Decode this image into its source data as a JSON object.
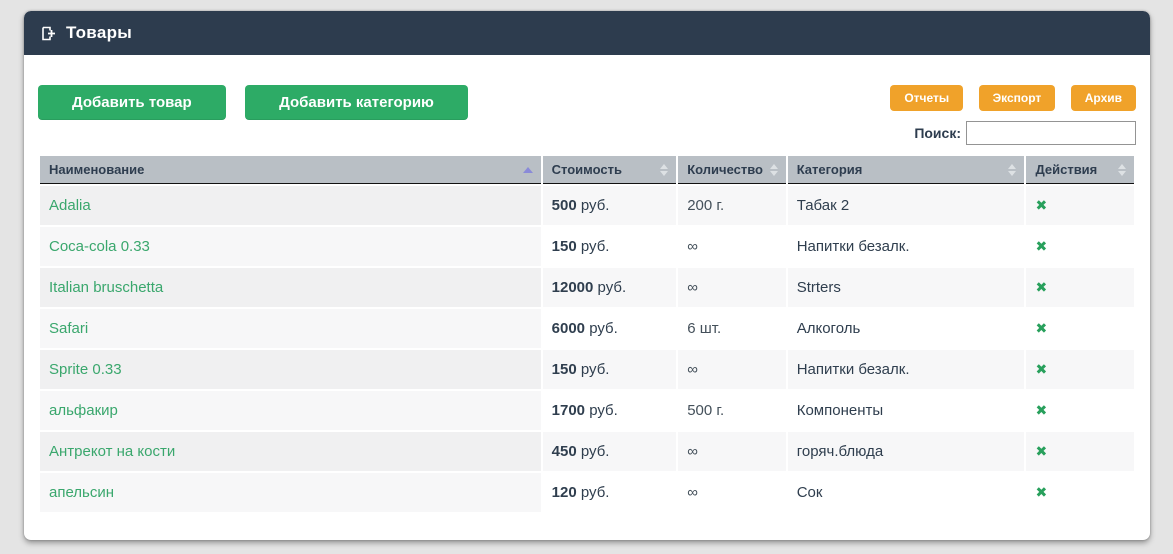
{
  "header": {
    "title": "Товары"
  },
  "toolbar": {
    "add_product_label": "Добавить товар",
    "add_category_label": "Добавить категорию",
    "reports_label": "Отчеты",
    "export_label": "Экспорт",
    "archive_label": "Архив",
    "search_label": "Поиск:",
    "search_value": ""
  },
  "table": {
    "action_icon": "✖",
    "columns": [
      {
        "label": "Наименование",
        "sort": "asc"
      },
      {
        "label": "Стоимость",
        "sort": "none"
      },
      {
        "label": "Количество",
        "sort": "none"
      },
      {
        "label": "Категория",
        "sort": "none"
      },
      {
        "label": "Действия",
        "sort": "none"
      }
    ],
    "rows": [
      {
        "name": "Adalia",
        "price": "500",
        "price_unit": "руб.",
        "quantity": "200 г.",
        "category": "Табак 2"
      },
      {
        "name": "Coca-cola 0.33",
        "price": "150",
        "price_unit": "руб.",
        "quantity": "∞",
        "category": "Напитки безалк."
      },
      {
        "name": "Italian bruschetta",
        "price": "12000",
        "price_unit": "руб.",
        "quantity": "∞",
        "category": "Strters"
      },
      {
        "name": "Safari",
        "price": "6000",
        "price_unit": "руб.",
        "quantity": "6 шт.",
        "category": "Алкоголь"
      },
      {
        "name": "Sprite 0.33",
        "price": "150",
        "price_unit": "руб.",
        "quantity": "∞",
        "category": "Напитки безалк."
      },
      {
        "name": "альфакир",
        "price": "1700",
        "price_unit": "руб.",
        "quantity": "500 г.",
        "category": "Компоненты"
      },
      {
        "name": "Антрекот на кости",
        "price": "450",
        "price_unit": "руб.",
        "quantity": "∞",
        "category": "горяч.блюда"
      },
      {
        "name": "апельсин",
        "price": "120",
        "price_unit": "руб.",
        "quantity": "∞",
        "category": "Сок"
      }
    ]
  },
  "colors": {
    "header_bg": "#2d3c4e",
    "green_button": "#2dab66",
    "orange_button": "#f0a22a",
    "table_header_bg": "#b9bfc5",
    "product_link": "#3aa76d",
    "delete_icon": "#28a05c",
    "active_sort_arrow": "#8a8ad8"
  }
}
